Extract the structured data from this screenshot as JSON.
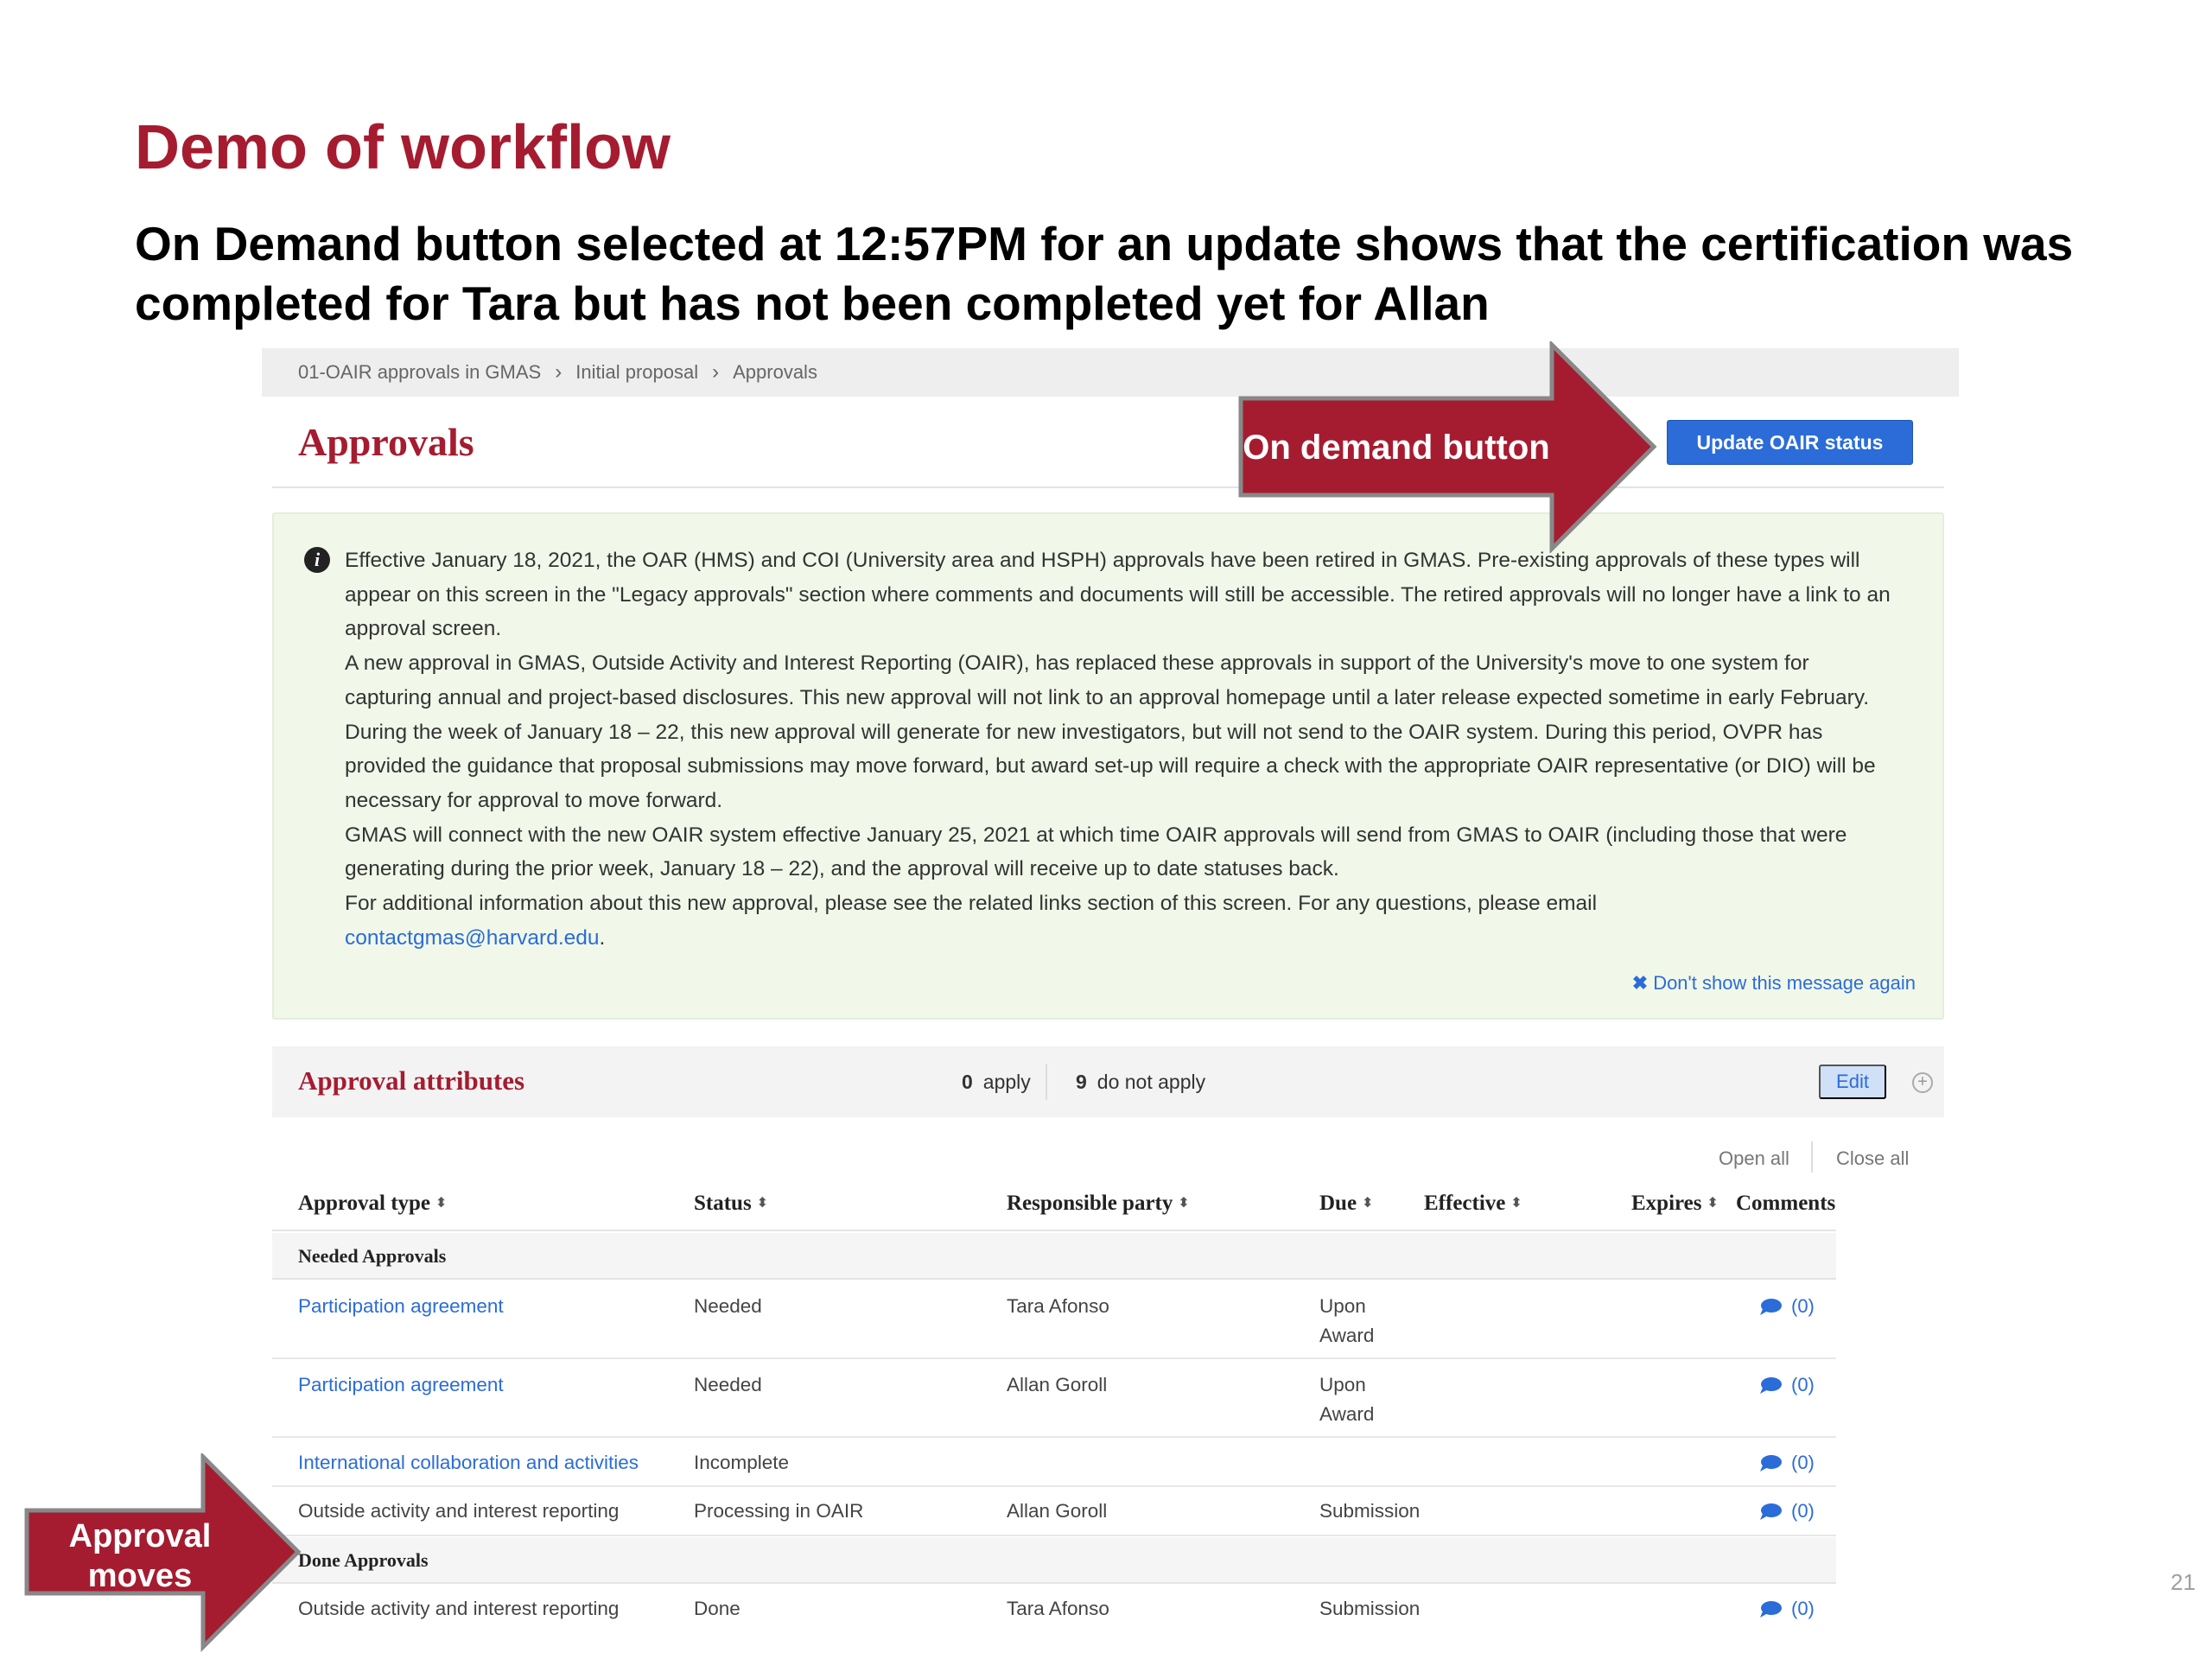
{
  "slide": {
    "title": "Demo of workflow",
    "subtitle": "On Demand button selected at 12:57PM for an update shows that the certification was completed for Tara but has not been completed yet for Allan",
    "page_number": "21",
    "callout_top": "On demand button",
    "callout_bottom_line1": "Approval",
    "callout_bottom_line2": "moves",
    "accent_color": "#a51c30"
  },
  "breadcrumb": [
    "01-OAIR approvals in GMAS",
    "Initial proposal",
    "Approvals"
  ],
  "header": {
    "title": "Approvals",
    "update_button": "Update OAIR status"
  },
  "notice": {
    "icon": "info-icon",
    "paragraphs": [
      "Effective January 18, 2021, the OAR (HMS) and COI (University area and HSPH) approvals have been retired in GMAS. Pre-existing approvals of these types will appear on this screen in the \"Legacy approvals\" section where comments and documents will still be accessible. The retired approvals will no longer have a link to an approval screen.",
      "A new approval in GMAS, Outside Activity and Interest Reporting (OAIR), has replaced these approvals in support of the University's move to one system for capturing annual and project-based disclosures. This new approval will not link to an approval homepage until a later release expected sometime in early February.",
      "During the week of January 18 – 22, this new approval will generate for new investigators, but will not send to the OAIR system. During this period, OVPR has provided the guidance that proposal submissions may move forward, but award set-up will require a check with the appropriate OAIR representative (or DIO) will be necessary for approval to move forward.",
      "GMAS will connect with the new OAIR system effective January 25, 2021 at which time OAIR approvals will send from GMAS to OAIR (including those that were generating during the prior week, January 18 – 22), and the approval will receive up to date statuses back.",
      "For additional information about this new approval, please see the related links section of this screen. For any questions, please email"
    ],
    "email": "contactgmas@harvard.edu",
    "email_suffix": ".",
    "dismiss": "Don't show this message again"
  },
  "attributes": {
    "title": "Approval attributes",
    "apply_count": "0",
    "apply_label": "apply",
    "not_apply_count": "9",
    "not_apply_label": "do not apply",
    "edit": "Edit",
    "open_all": "Open all",
    "close_all": "Close all"
  },
  "table": {
    "columns": [
      "Approval type",
      "Status",
      "Responsible party",
      "Due",
      "Effective",
      "Expires",
      "Comments"
    ],
    "groups": {
      "needed": "Needed Approvals",
      "done": "Done Approvals"
    },
    "needed_rows": [
      {
        "type": "Participation agreement",
        "link": true,
        "status": "Needed",
        "party": "Tara Afonso",
        "due1": "Upon",
        "due2": "Award",
        "comments": "(0)"
      },
      {
        "type": "Participation agreement",
        "link": true,
        "status": "Needed",
        "party": "Allan Goroll",
        "due1": "Upon",
        "due2": "Award",
        "comments": "(0)"
      },
      {
        "type": "International collaboration and activities",
        "link": true,
        "status": "Incomplete",
        "party": "",
        "due1": "",
        "due2": "",
        "comments": "(0)"
      },
      {
        "type": "Outside activity and interest reporting",
        "link": false,
        "status": "Processing in OAIR",
        "party": "Allan Goroll",
        "due1": "Submission",
        "due2": "",
        "comments": "(0)"
      }
    ],
    "done_rows": [
      {
        "type": "Outside activity and interest reporting",
        "link": false,
        "status": "Done",
        "party": "Tara Afonso",
        "due1": "Submission",
        "due2": "",
        "comments": "(0)"
      }
    ]
  }
}
